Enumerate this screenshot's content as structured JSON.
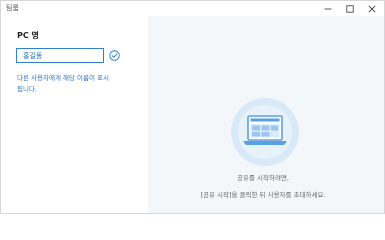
{
  "window": {
    "title": "팀룸"
  },
  "left_panel": {
    "pc_name_label": "PC 명",
    "pc_name_value": "홍길동",
    "hint_text": "다른 사용자에게 해당 이름이 표시됩니다."
  },
  "right_panel": {
    "line1": "공유를 시작하려면,",
    "line2": "[공유 시작]을 클릭한 뒤 사용자를 초대하세요."
  },
  "colors": {
    "accent": "#2f80d1",
    "right_background": "#f4f7fa",
    "illustration_circle": "#d9e9f8"
  },
  "icons": {
    "check": "check-circle-icon",
    "illustration": "laptop-illustration"
  }
}
